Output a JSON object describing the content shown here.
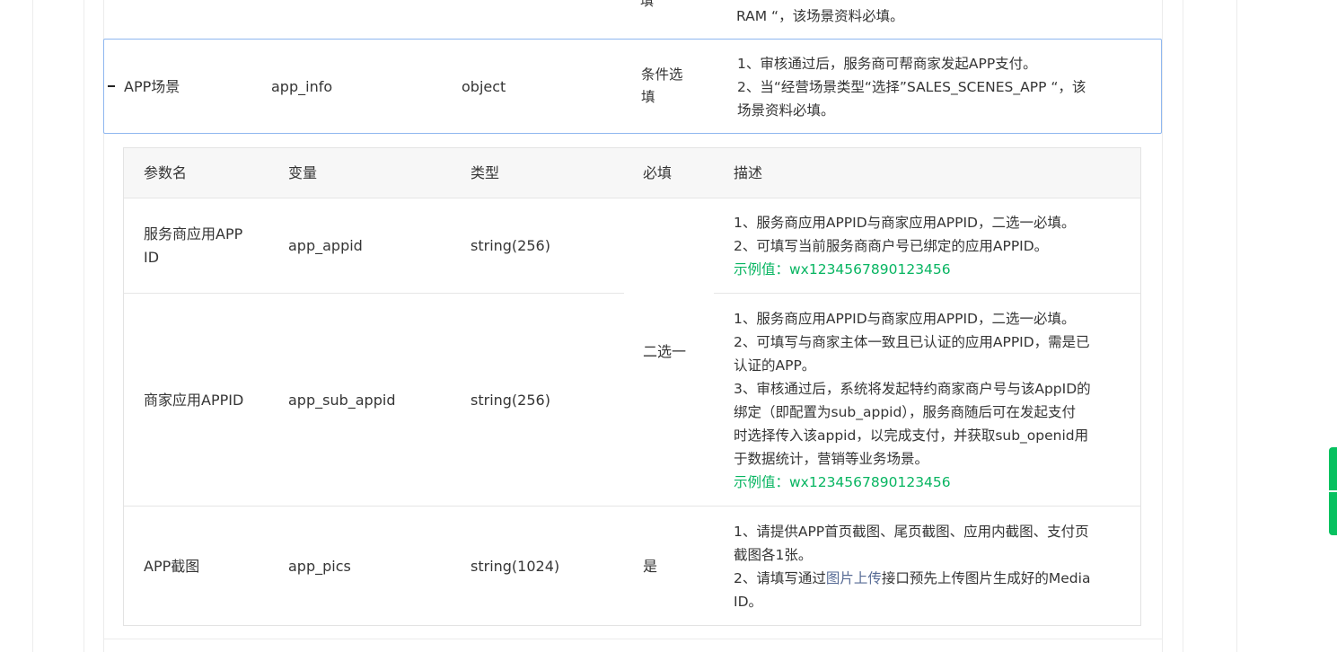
{
  "prev_row": {
    "required_tail": "填",
    "desc_tail": "RAM “，该场景资料必填。"
  },
  "main_row": {
    "name": "APP场景",
    "var": "app_info",
    "type": "object",
    "required_l1": "条件选",
    "required_l2": "填",
    "desc_l1": "1、审核通过后，服务商可帮商家发起APP支付。",
    "desc_l2": "2、当“经营场景类型“选择”SALES_SCENES_APP “，该",
    "desc_l3": "场景资料必填。"
  },
  "subtable": {
    "headers": [
      "参数名",
      "变量",
      "类型",
      "必填",
      "描述"
    ],
    "rows": [
      {
        "name_l1": "服务商应用APP",
        "name_l2": "ID",
        "var": "app_appid",
        "type": "string(256)",
        "desc": [
          "1、服务商应用APPID与商家应用APPID，二选一必填。",
          "2、可填写当前服务商商户号已绑定的应用APPID。"
        ],
        "example": "示例值：wx1234567890123456"
      },
      {
        "name": "商家应用APPID",
        "var": "app_sub_appid",
        "type": "string(256)",
        "desc": [
          "1、服务商应用APPID与商家应用APPID，二选一必填。",
          "2、可填写与商家主体一致且已认证的应用APPID，需是已",
          "认证的APP。",
          "3、审核通过后，系统将发起特约商家商户号与该AppID的",
          "绑定（即配置为sub_appid），服务商随后可在发起支付",
          "时选择传入该appid，以完成支付，并获取sub_openid用",
          "于数据统计，营销等业务场景。"
        ],
        "example": "示例值：wx1234567890123456"
      },
      {
        "name": "APP截图",
        "var": "app_pics",
        "type": "string(1024)",
        "required": "是",
        "desc_l1": "1、请提供APP首页截图、尾页截图、应用内截图、支付页",
        "desc_l2": "截图各1张。",
        "desc_l3_pre": "2、请填写通过",
        "desc_l3_link": "图片上传",
        "desc_l3_post": "接口预先上传图片生成好的Media",
        "desc_l4": "ID。"
      }
    ],
    "merged_required": "二选一"
  },
  "colors": {
    "accent_border": "#8fb7ef",
    "example_green": "#07b561",
    "link_blue": "#576b95",
    "scroll_indicator": "#07c160"
  }
}
